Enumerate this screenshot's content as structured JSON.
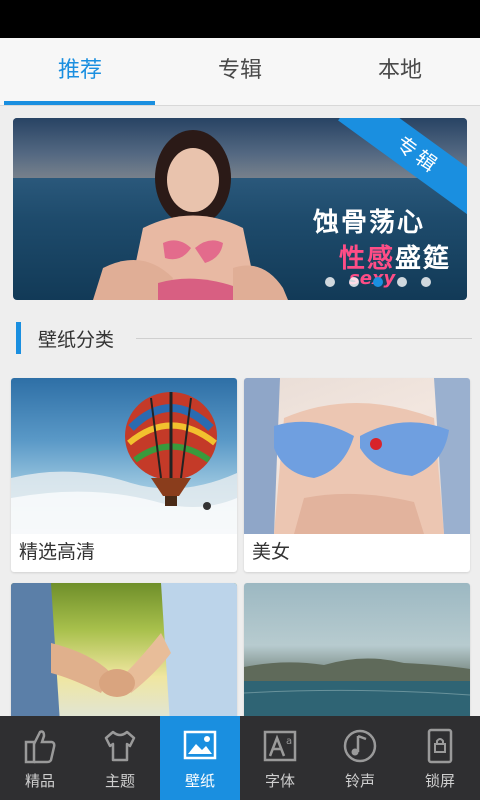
{
  "tabs": [
    {
      "label": "推荐",
      "active": true
    },
    {
      "label": "专辑",
      "active": false
    },
    {
      "label": "本地",
      "active": false
    }
  ],
  "banner": {
    "ribbon": "专辑",
    "title_line1": "蚀骨荡心",
    "title_line2_pink": "性感",
    "title_line2_white": "盛筵",
    "sexy_text": "sexy",
    "dot_count": 5,
    "active_dot": 3
  },
  "section": {
    "title": "壁纸分类"
  },
  "categories": [
    {
      "label": "精选高清",
      "image": "hot-air-balloon"
    },
    {
      "label": "美女",
      "image": "woman-blue-bra"
    },
    {
      "label": "",
      "image": "holding-hands"
    },
    {
      "label": "",
      "image": "seaside-island"
    }
  ],
  "bottom_nav": [
    {
      "label": "精品",
      "icon": "thumbs-up-icon",
      "active": false
    },
    {
      "label": "主题",
      "icon": "tshirt-icon",
      "active": false
    },
    {
      "label": "壁纸",
      "icon": "picture-icon",
      "active": true
    },
    {
      "label": "字体",
      "icon": "font-icon",
      "active": false
    },
    {
      "label": "铃声",
      "icon": "music-note-icon",
      "active": false
    },
    {
      "label": "锁屏",
      "icon": "lock-screen-icon",
      "active": false
    }
  ],
  "colors": {
    "accent": "#1a8fe0",
    "nav_bg": "#2f2f31",
    "pink": "#ff4d86"
  }
}
